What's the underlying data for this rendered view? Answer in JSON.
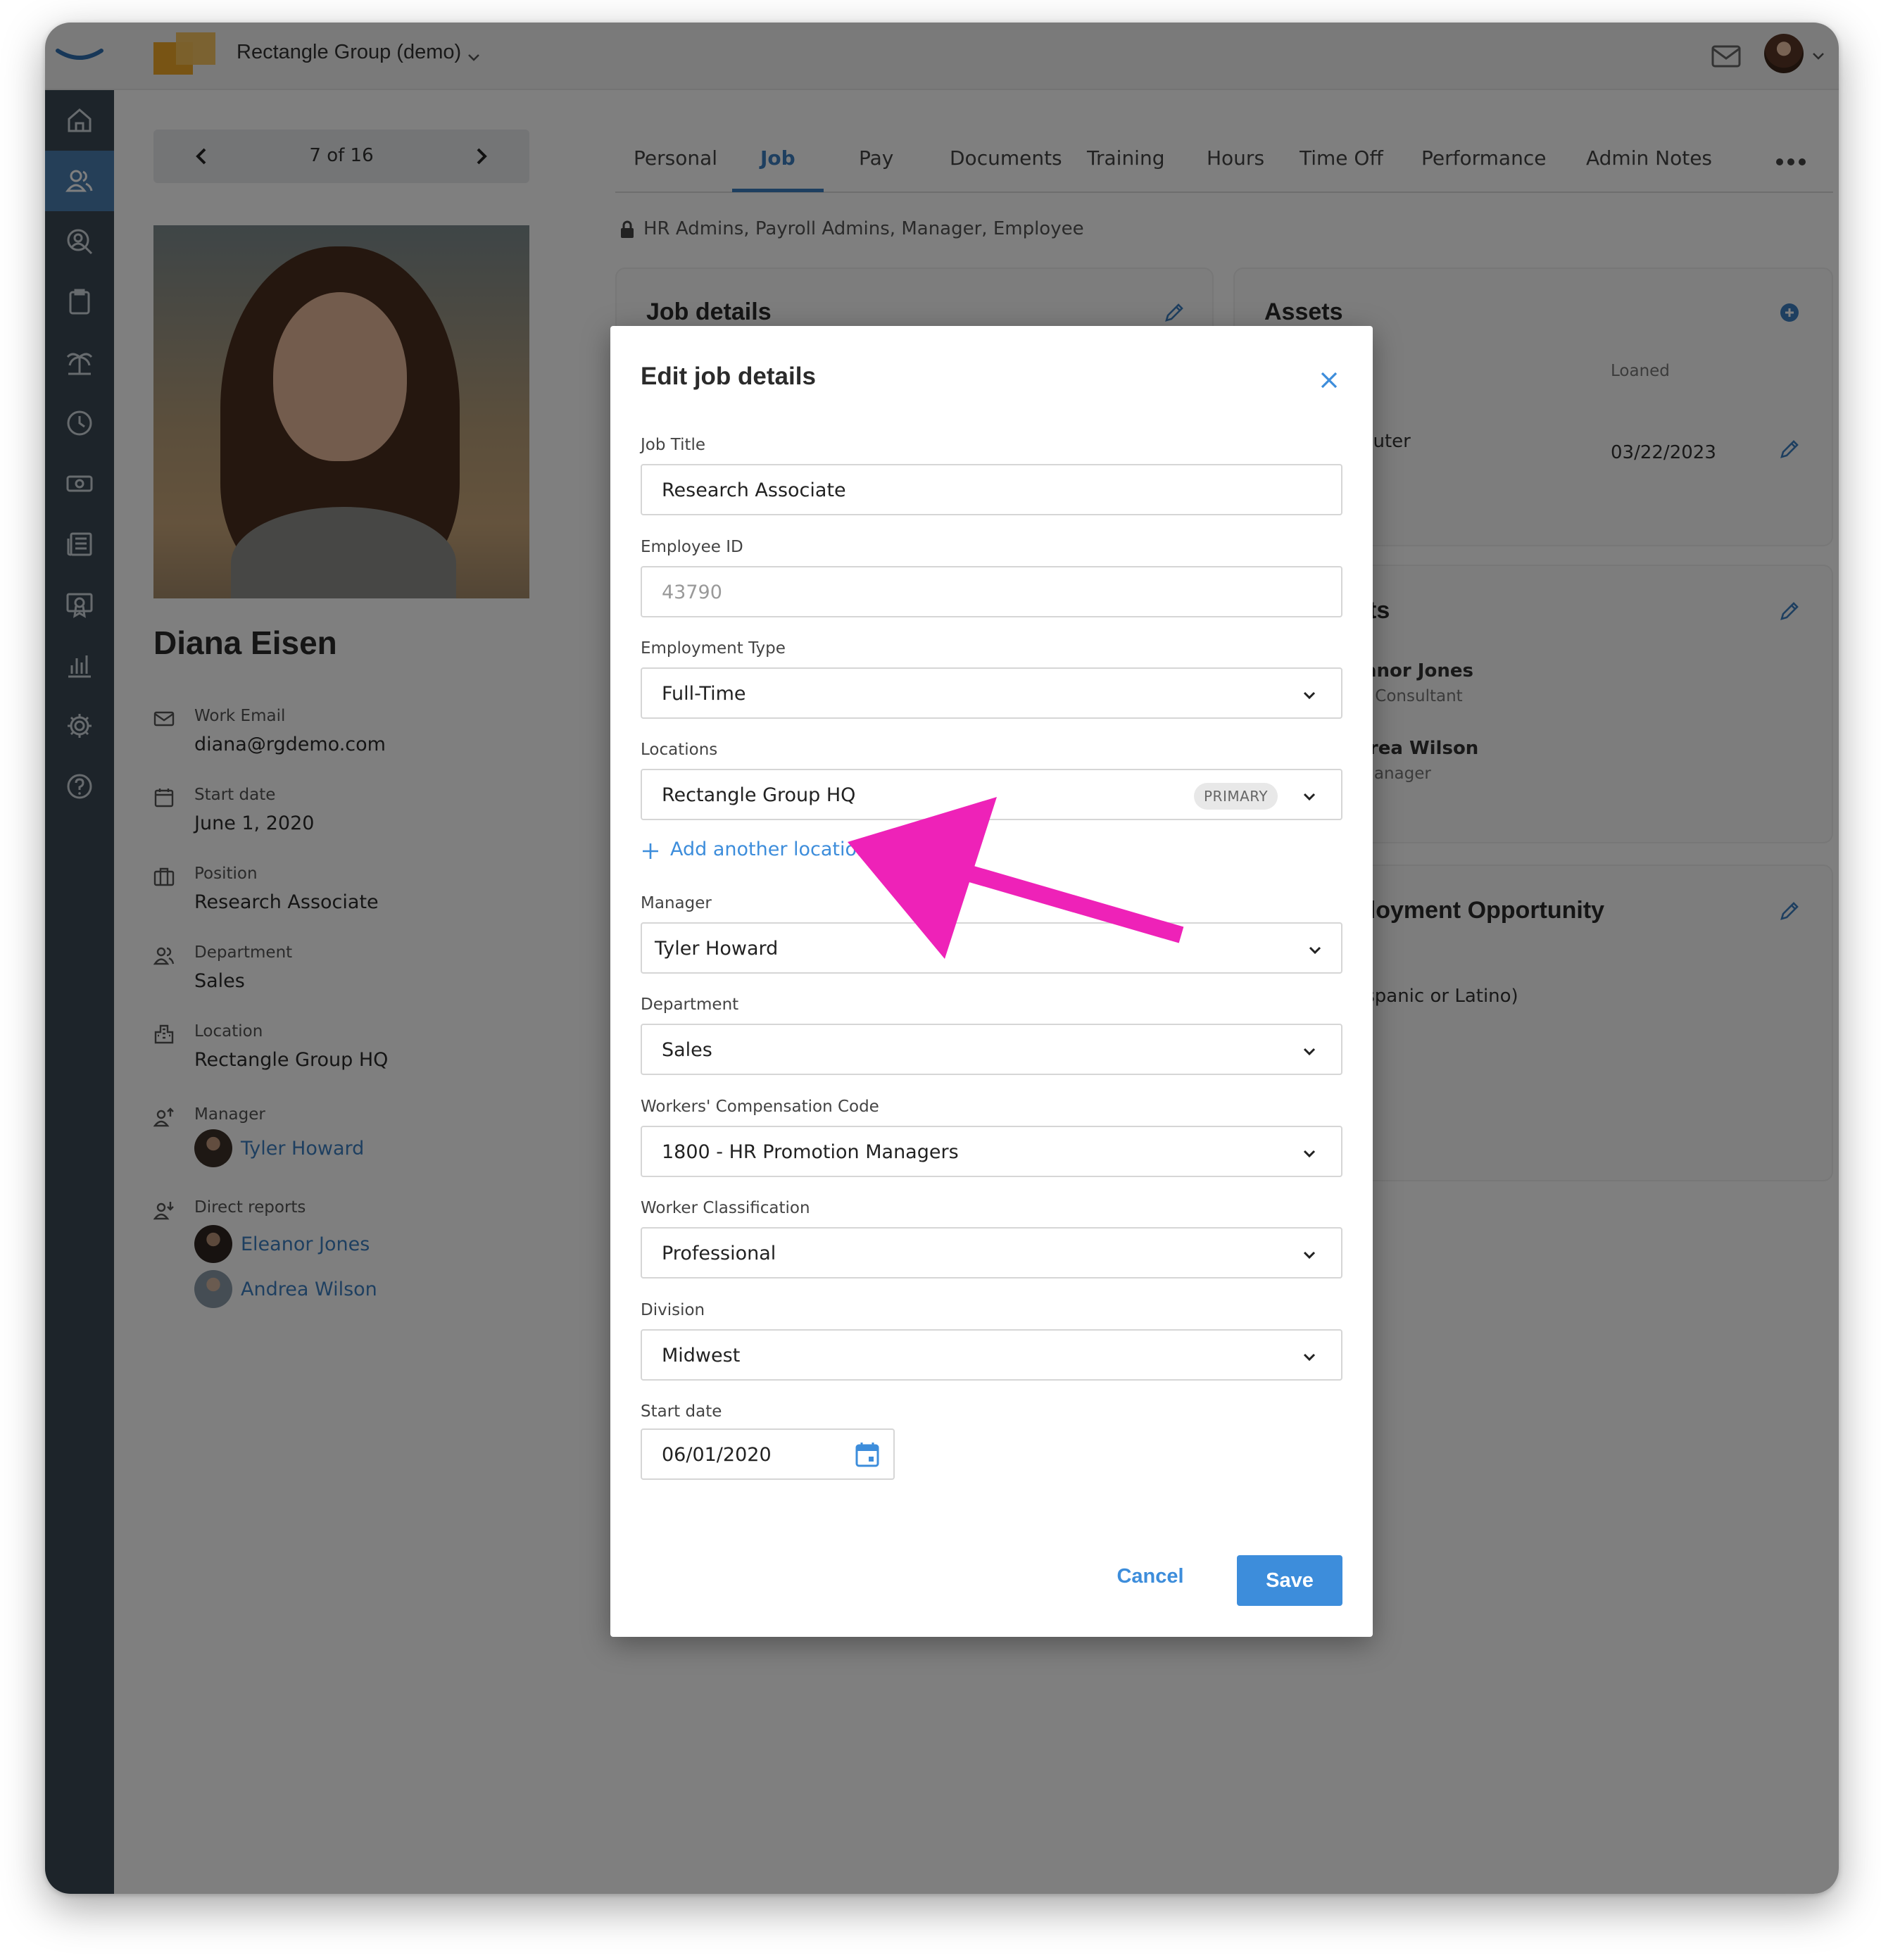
{
  "topbar": {
    "org_name": "Rectangle Group (demo)",
    "icons": [
      "app-logo",
      "org-logo",
      "chevron-down-icon",
      "mail-icon",
      "user-avatar",
      "chevron-down-icon"
    ]
  },
  "leftnav": {
    "active_index": 1,
    "icons": [
      "home-icon",
      "people-icon",
      "search-person-icon",
      "clipboard-icon",
      "palm-tree-icon",
      "clock-icon",
      "money-icon",
      "news-icon",
      "certificate-icon",
      "bar-chart-icon",
      "gear-icon",
      "help-icon"
    ]
  },
  "pager": {
    "label": "7 of 16"
  },
  "employee": {
    "name": "Diana Eisen",
    "work_email_label": "Work Email",
    "work_email": "diana@rgdemo.com",
    "start_date_label": "Start date",
    "start_date": "June 1, 2020",
    "position_label": "Position",
    "position": "Research Associate",
    "department_label": "Department",
    "department": "Sales",
    "location_label": "Location",
    "location": "Rectangle Group HQ",
    "manager_label": "Manager",
    "manager": "Tyler Howard",
    "direct_reports_label": "Direct reports",
    "direct_reports": [
      "Eleanor Jones",
      "Andrea Wilson"
    ]
  },
  "tabs": [
    "Personal",
    "Job",
    "Pay",
    "Documents",
    "Training",
    "Hours",
    "Time Off",
    "Performance",
    "Admin Notes"
  ],
  "active_tab": "Job",
  "access_note": "HR Admins, Payroll Admins, Manager, Employee",
  "cards": {
    "job_details_title": "Job details",
    "assets_title": "Assets",
    "assets_col_loaned": "Loaned",
    "assets_item_partial": "puter",
    "assets_item_date": "03/22/2023",
    "reports_title_partial": "orts",
    "report_1_name_partial": "anor Jones",
    "report_1_role_partial": "s Consultant",
    "report_2_name_partial": "lrea Wilson",
    "report_2_role_partial": "Manager",
    "eeo_title_partial": "ployment Opportunity",
    "eeo_value_partial": "ispanic or Latino)",
    "eeo_small_partial": "s"
  },
  "modal": {
    "title": "Edit job details",
    "job_title_label": "Job Title",
    "job_title_value": "Research Associate",
    "employee_id_label": "Employee ID",
    "employee_id_value": "43790",
    "employment_type_label": "Employment Type",
    "employment_type_value": "Full-Time",
    "locations_label": "Locations",
    "locations_value": "Rectangle Group HQ",
    "locations_badge": "PRIMARY",
    "add_location_label": "Add another location",
    "manager_label": "Manager",
    "manager_value": "Tyler Howard",
    "department_label": "Department",
    "department_value": "Sales",
    "workers_comp_label": "Workers' Compensation Code",
    "workers_comp_value": "1800 - HR Promotion Managers",
    "worker_class_label": "Worker Classification",
    "worker_class_value": "Professional",
    "division_label": "Division",
    "division_value": "Midwest",
    "start_date_label": "Start date",
    "start_date_value": "06/01/2020",
    "cancel_label": "Cancel",
    "save_label": "Save"
  },
  "colors": {
    "accent": "#3d8ddb",
    "nav_bg": "#3b4954",
    "nav_active": "#4a7fb0",
    "annotation_arrow": "#ee22b8",
    "org_logo": "#f0a829"
  }
}
